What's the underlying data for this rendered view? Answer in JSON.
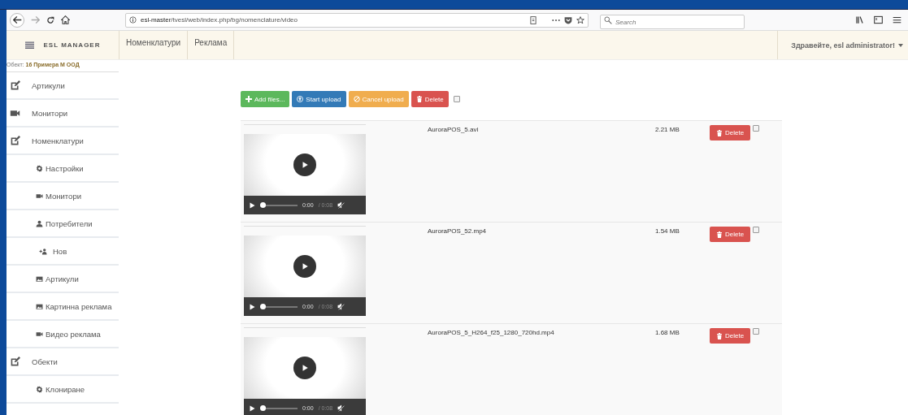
{
  "browser": {
    "url_host": "esl-master",
    "url_path": "/tvesl/web/index.php/bg/nomenclature/video",
    "search_placeholder": "Search"
  },
  "header": {
    "brand": "ESL MANAGER",
    "nav": [
      "Номенклатури",
      "Реклама"
    ],
    "user_menu": "Здравейте, esl administrator!"
  },
  "object": {
    "label": "Обект:",
    "name": "16 Примера М ООД"
  },
  "sidebar": {
    "items": [
      {
        "label": "Артикули",
        "kind": "main"
      },
      {
        "label": "Монитори",
        "kind": "main"
      },
      {
        "label": "Номенклатури",
        "kind": "main"
      },
      {
        "label": "Настройки",
        "kind": "sub"
      },
      {
        "label": "Монитори",
        "kind": "sub"
      },
      {
        "label": "Потребители",
        "kind": "sub"
      },
      {
        "label": "Нов",
        "kind": "sub"
      },
      {
        "label": "Артикули",
        "kind": "sub"
      },
      {
        "label": "Картинна реклама",
        "kind": "sub"
      },
      {
        "label": "Видео реклама",
        "kind": "sub"
      },
      {
        "label": "Обекти",
        "kind": "main"
      },
      {
        "label": "Клониране",
        "kind": "sub"
      }
    ]
  },
  "toolbar": {
    "buttons": [
      {
        "label": "Add files...",
        "kind": "add"
      },
      {
        "label": "Start upload",
        "kind": "start"
      },
      {
        "label": "Cancel upload",
        "kind": "cancel"
      },
      {
        "label": "Delete",
        "kind": "delete"
      }
    ],
    "select_all_checked": false
  },
  "files": [
    {
      "name": "AuroraPOS_5.avi",
      "size": "2.21 MB",
      "current_time": "0:00",
      "duration": "/ 0:08",
      "delete_label": "Delete",
      "checked": false
    },
    {
      "name": "AuroraPOS_52.mp4",
      "size": "1.54 MB",
      "current_time": "0:00",
      "duration": "/ 0:08",
      "delete_label": "Delete",
      "checked": false
    },
    {
      "name": "AuroraPOS_5_H264_f25_1280_720hd.mp4",
      "size": "1.68 MB",
      "current_time": "0:00",
      "duration": "/ 0:08",
      "delete_label": "Delete",
      "checked": false
    }
  ]
}
